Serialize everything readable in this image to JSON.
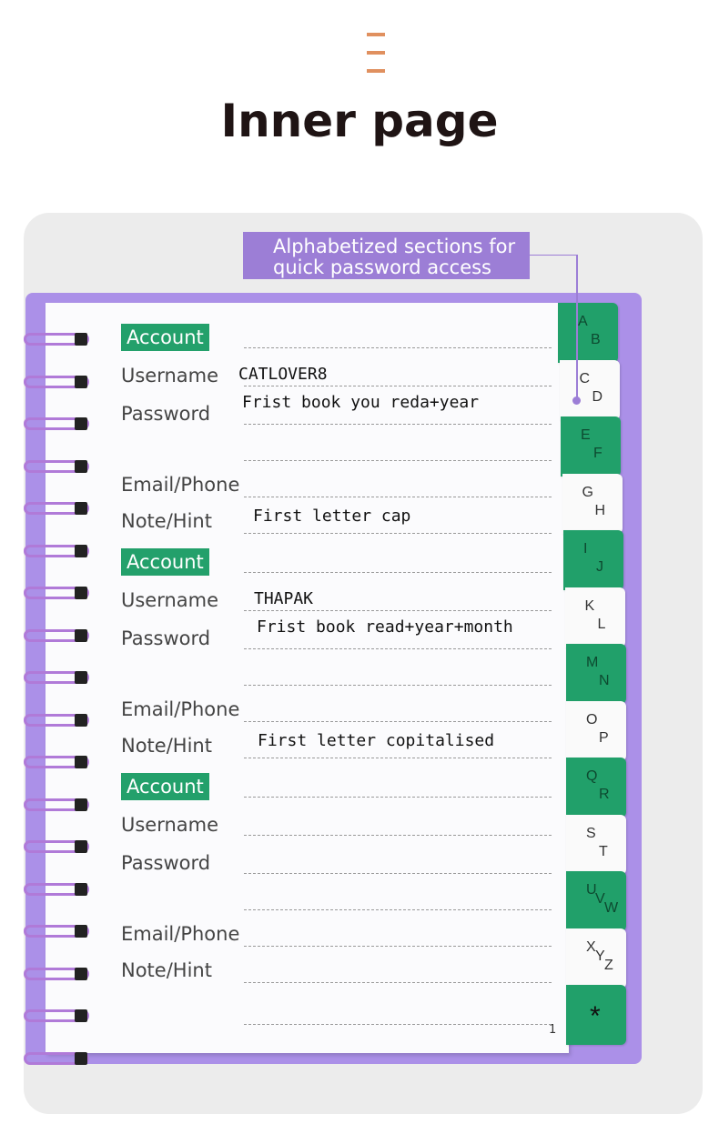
{
  "header": {
    "icon": "menu-bars-icon",
    "title": "Inner page"
  },
  "callout": {
    "text_line1": "Alphabetized sections for",
    "text_line2": "quick password access",
    "color": "#9c7ed6"
  },
  "colors": {
    "accent_green": "#23a06b",
    "cover_purple": "#ab90e8",
    "icon_orange": "#e0905f"
  },
  "labels": {
    "account": "Account",
    "username": "Username",
    "password": "Password",
    "email": "Email/Phone",
    "note": "Note/Hint"
  },
  "entries": [
    {
      "username": "CATLOVER8",
      "password": "Frist book you reda+year",
      "note": "First letter cap"
    },
    {
      "username": "THAPAK",
      "password": "Frist book read+year+month",
      "note": "First letter copitalised"
    },
    {
      "username": "",
      "password": "",
      "note": ""
    }
  ],
  "tabs": [
    [
      "A",
      "B"
    ],
    [
      "C",
      "D"
    ],
    [
      "E",
      "F"
    ],
    [
      "G",
      "H"
    ],
    [
      "I",
      "J"
    ],
    [
      "K",
      "L"
    ],
    [
      "M",
      "N"
    ],
    [
      "O",
      "P"
    ],
    [
      "Q",
      "R"
    ],
    [
      "S",
      "T"
    ],
    [
      "U",
      "V",
      "W"
    ],
    [
      "X",
      "Y",
      "Z"
    ],
    [
      "*"
    ]
  ],
  "page_number": "1"
}
